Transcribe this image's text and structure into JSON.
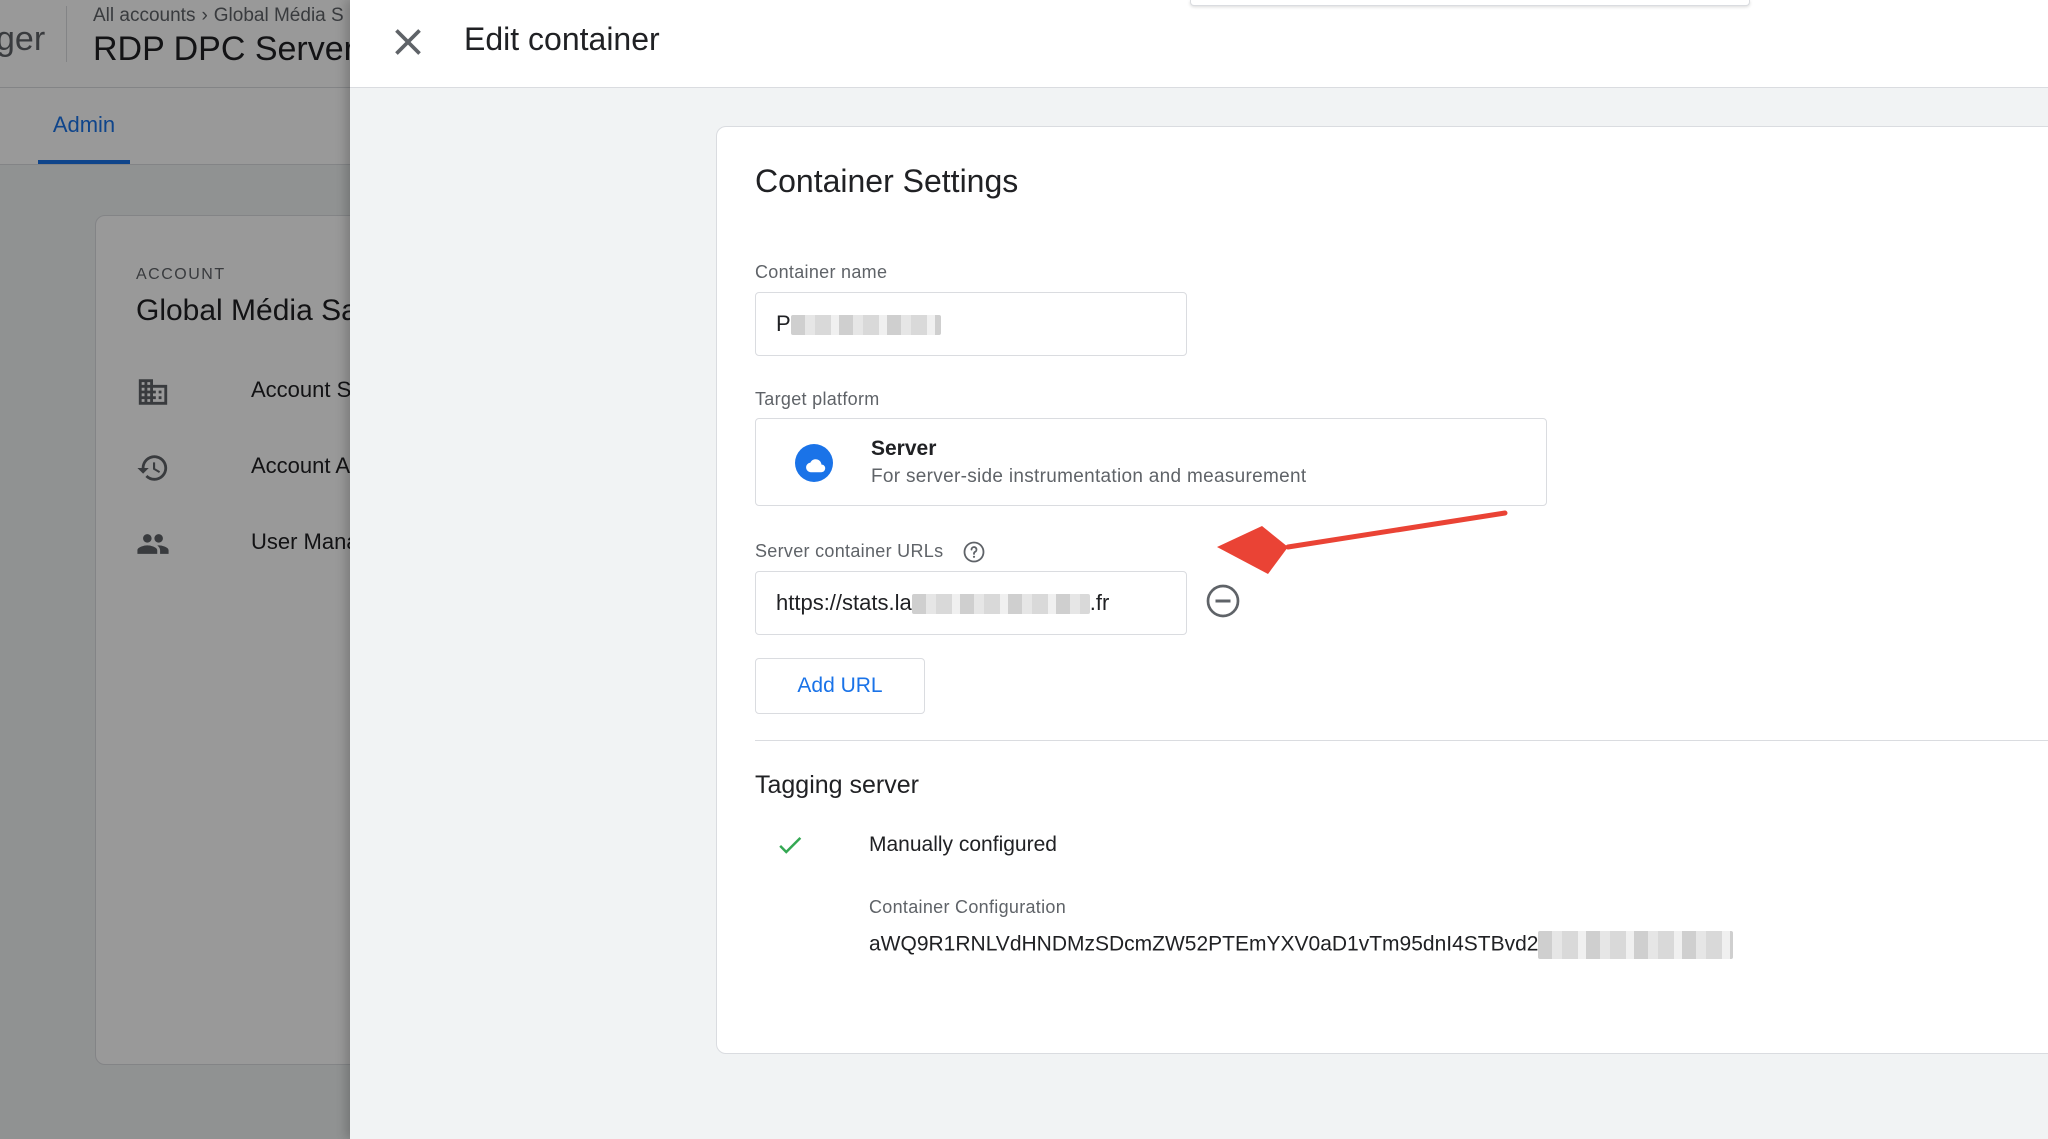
{
  "background": {
    "app_name_fragment": "ger",
    "breadcrumb": {
      "all_accounts": "All accounts",
      "account": "Global Média S"
    },
    "container_title": "RDP DPC Server",
    "tab_admin": "Admin",
    "account_section": {
      "label": "ACCOUNT",
      "name": "Global Média Sa",
      "items": [
        {
          "label": "Account Setti",
          "icon": "building-icon"
        },
        {
          "label": "Account Activ",
          "icon": "history-icon"
        },
        {
          "label": "User Manager",
          "icon": "people-icon"
        }
      ]
    }
  },
  "panel": {
    "title": "Edit container",
    "close_icon": "close-icon",
    "settings": {
      "title": "Container Settings",
      "container_name_label": "Container name",
      "container_name_value": "P",
      "target_platform_label": "Target platform",
      "platform": {
        "name": "Server",
        "description": "For server-side instrumentation and measurement",
        "icon": "cloud-icon"
      },
      "server_urls_label": "Server container URLs",
      "server_url_prefix": "https://stats.la",
      "server_url_suffix": ".fr",
      "add_url_label": "Add URL",
      "tagging_server_title": "Tagging server",
      "config_status": "Manually configured",
      "container_configuration_label": "Container Configuration",
      "container_configuration_value": "aWQ9R1RNLVdHNDMzSDcmZW52PTEmYXV0aD1vTm95dnI4STBvd2"
    }
  },
  "colors": {
    "accent": "#1a73e8",
    "check": "#34a853",
    "annotation": "#ea4335"
  }
}
